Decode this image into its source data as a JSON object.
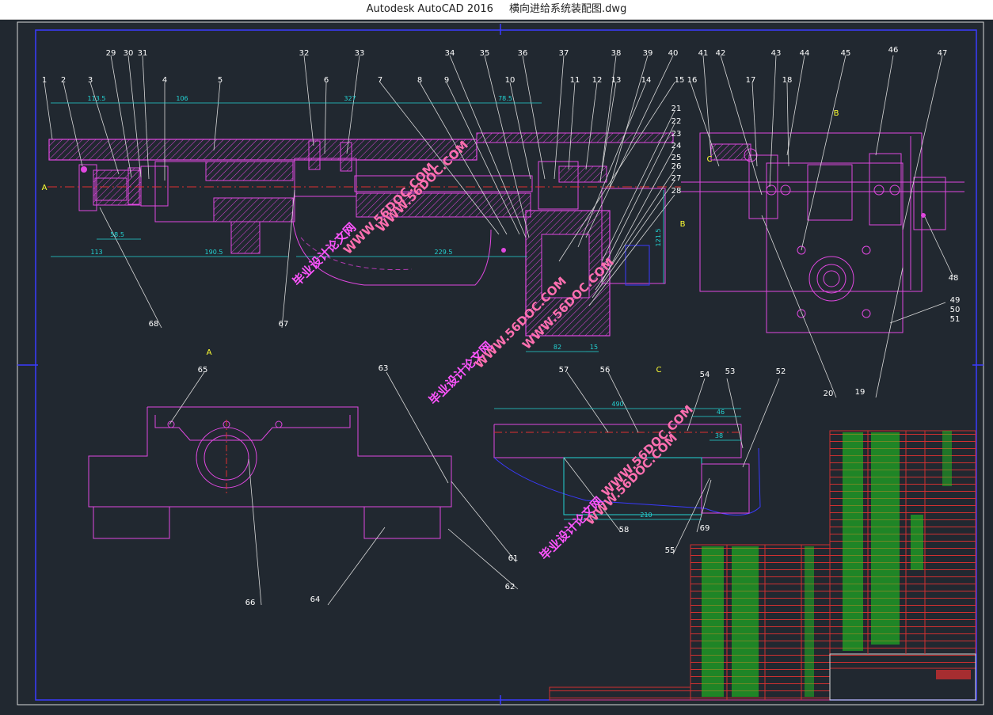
{
  "window": {
    "app_title": "Autodesk AutoCAD 2016",
    "file_name": "横向进给系统装配图.dwg"
  },
  "drawing": {
    "section_labels": {
      "A_left": "A",
      "A_view": "A",
      "B_top": "B",
      "B_mid": "B",
      "C_mid": "C",
      "C_view": "C"
    },
    "part_numbers": {
      "p1": "1",
      "p2": "2",
      "p3": "3",
      "p29": "29",
      "p30": "30",
      "p31": "31",
      "p4": "4",
      "p5": "5",
      "p32": "32",
      "p6": "6",
      "p33": "33",
      "p7": "7",
      "p8": "8",
      "p9": "9",
      "p34": "34",
      "p35": "35",
      "p10": "10",
      "p36": "36",
      "p37": "37",
      "p11": "11",
      "p12": "12",
      "p13": "13",
      "p38": "38",
      "p39": "39",
      "p14": "14",
      "p40": "40",
      "p15": "15",
      "p21": "21",
      "p22": "22",
      "p23": "23",
      "p24": "24",
      "p25": "25",
      "p26": "26",
      "p27": "27",
      "p28": "28",
      "p41": "41",
      "p42": "42",
      "p16": "16",
      "p43": "43",
      "p17": "17",
      "p18": "18",
      "p44": "44",
      "p45": "45",
      "p46": "46",
      "p47": "47",
      "p48": "48",
      "p49": "49",
      "p50": "50",
      "p51": "51",
      "p20": "20",
      "p19": "19",
      "p68": "68",
      "p67": "67",
      "p65": "65",
      "p66": "66",
      "p64": "64",
      "p63": "63",
      "p61": "61",
      "p62": "62",
      "p57": "57",
      "p56": "56",
      "p54": "54",
      "p53": "53",
      "p52": "52",
      "p58": "58",
      "p69": "69",
      "p55": "55"
    },
    "dimensions": {
      "d113_5": "113.5",
      "d106": "106",
      "d327": "327",
      "d78_5": "78.5",
      "d58_5": "58.5",
      "d113": "113",
      "d190_5": "190.5",
      "d229_5": "229.5",
      "d82": "82",
      "d15": "15",
      "d121_5": "121.5",
      "d490": "490",
      "d46": "46",
      "d38": "38",
      "d210": "210"
    },
    "watermarks": {
      "site_cn": "毕业设计论文网",
      "site_url": "WWW.56DOC.COM"
    }
  }
}
